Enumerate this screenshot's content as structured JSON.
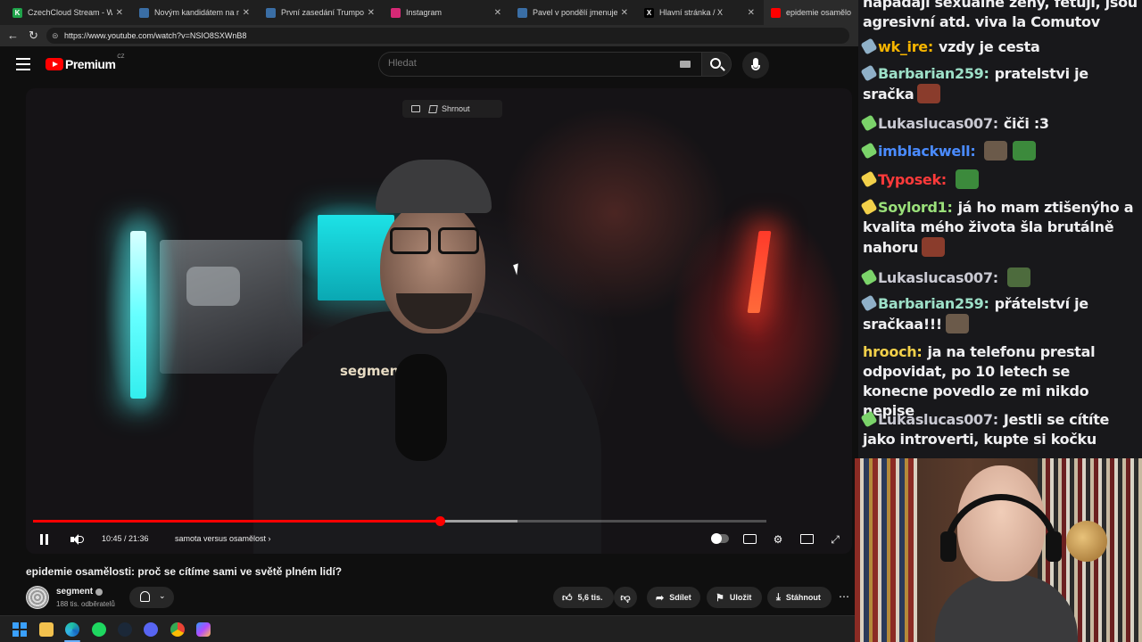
{
  "browser": {
    "tabs": [
      {
        "title": "CzechCloud Stream - Watch",
        "icon_color": "#1fa34a",
        "icon_char": "K"
      },
      {
        "title": "Novým kandidátem na minis",
        "icon_color": "#3a6ea5",
        "icon_char": ""
      },
      {
        "title": "První zasedání Trumpovy",
        "icon_color": "#3a6ea5",
        "icon_char": ""
      },
      {
        "title": "Instagram",
        "icon_color": "#d62976",
        "icon_char": ""
      },
      {
        "title": "Pavel v pondělí jmenuje Č",
        "icon_color": "#3a6ea5",
        "icon_char": ""
      },
      {
        "title": "Hlavní stránka / X",
        "icon_color": "#000000",
        "icon_char": "X"
      },
      {
        "title": "epidemie osamělost",
        "icon_color": "#ff0000",
        "icon_char": ""
      }
    ],
    "tab_close_glyph": "✕",
    "url": "https://www.youtube.com/watch?v=NSIO8SXWnB8"
  },
  "youtube": {
    "logo_text": "Premium",
    "logo_region": "CZ",
    "search_placeholder": "Hledat",
    "summary_chip": "Shrnout",
    "time": "10:45 / 21:36",
    "progress": {
      "played": 0.555,
      "loaded": 0.66
    },
    "chapter": "samota versus osamělost ›",
    "shirt_text": "segmen",
    "title": "epidemie osamělosti: proč se cítíme sami ve světě plném lidí?",
    "channel": "segment",
    "subscribers": "188 tis. odběratelů",
    "likes": "5,6 tis.",
    "share_label": "Sdílet",
    "save_label": "Uložit",
    "download_label": "Stáhnout"
  },
  "chat": {
    "messages": [
      {
        "user": "",
        "color": "#efeff1",
        "text": "napadají sexuálně ženy, fetují, jsou agresivní atd. viva la Comutov",
        "badge": ""
      },
      {
        "user": "wk_ire:",
        "color": "#f5b400",
        "text": "vzdy je cesta",
        "badge": "#8fb0c8"
      },
      {
        "user": "Barbarian259:",
        "color": "#9de0c8",
        "text": "pratelstvi je sračka",
        "badge": "#8fb0c8"
      },
      {
        "user": "Lukaslucas007:",
        "color": "#c9c9d2",
        "text": "čiči :3",
        "badge": "#7bd36a"
      },
      {
        "user": "imblackwell:",
        "color": "#4a8bff",
        "text": "",
        "badge": "#7bd36a"
      },
      {
        "user": "Typosek:",
        "color": "#ff3a3a",
        "text": "",
        "badge": "#f2d04a"
      },
      {
        "user": "Soylord1:",
        "color": "#9ae07a",
        "text": "já ho mam ztišenýho a kvalita mého života šla brutálně nahoru",
        "badge": "#f2d04a"
      },
      {
        "user": "Lukaslucas007:",
        "color": "#c9c9d2",
        "text": "",
        "badge": "#7bd36a"
      },
      {
        "user": "Barbarian259:",
        "color": "#9de0c8",
        "text": "přátelství je sračkaa!!!",
        "badge": "#8fb0c8"
      },
      {
        "user": "hrooch:",
        "color": "#f2d04a",
        "text": "ja na telefonu prestal odpovidat, po 10 letech se konecne povedlo ze mi nikdo nepise",
        "badge": ""
      },
      {
        "user": "Lukaslucas007:",
        "color": "#c9c9d2",
        "text": "Jestli se cítíte jako introverti, kupte si kočku",
        "badge": "#7bd36a"
      }
    ]
  },
  "colors": {
    "accent": "#ff0000",
    "chat_bg": "#18181b"
  }
}
